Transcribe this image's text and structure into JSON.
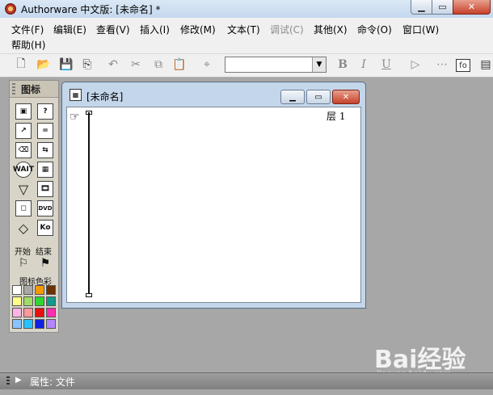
{
  "window": {
    "title": "Authorware 中文版: [未命名] *"
  },
  "menu": {
    "items": [
      "文件(F)",
      "编辑(E)",
      "查看(V)",
      "插入(I)",
      "修改(M)",
      "文本(T)",
      "调试(C)",
      "其他(X)",
      "命令(O)",
      "窗口(W)",
      "帮助(H)"
    ],
    "disabled_index": 6
  },
  "toolbar": {
    "font_select_value": "",
    "bold_label": "B",
    "italic_label": "I",
    "underline_label": "U",
    "fn_label": "fo"
  },
  "palette": {
    "title": "图标",
    "start_label": "开始",
    "end_label": "结束",
    "color_label": "图标色彩",
    "icon_text": {
      "wait": "WAIT",
      "dvd": "DVD",
      "ko": "Ko"
    },
    "swatches": [
      "#ffffff",
      "#a8a8a8",
      "#f39a00",
      "#6e3300",
      "#ffff88",
      "#9edc66",
      "#2fd62f",
      "#139a8a",
      "#ffb3e6",
      "#ff9999",
      "#e81010",
      "#ff2eb0",
      "#88c4ff",
      "#26c2ff",
      "#1022e0",
      "#b385ff"
    ]
  },
  "design_window": {
    "title": "[未命名]",
    "layer_label": "层 1"
  },
  "status": {
    "text": "属性: 文件"
  },
  "watermark": {
    "brand": "Bai经验",
    "url": "jingyan.baidu.com"
  }
}
